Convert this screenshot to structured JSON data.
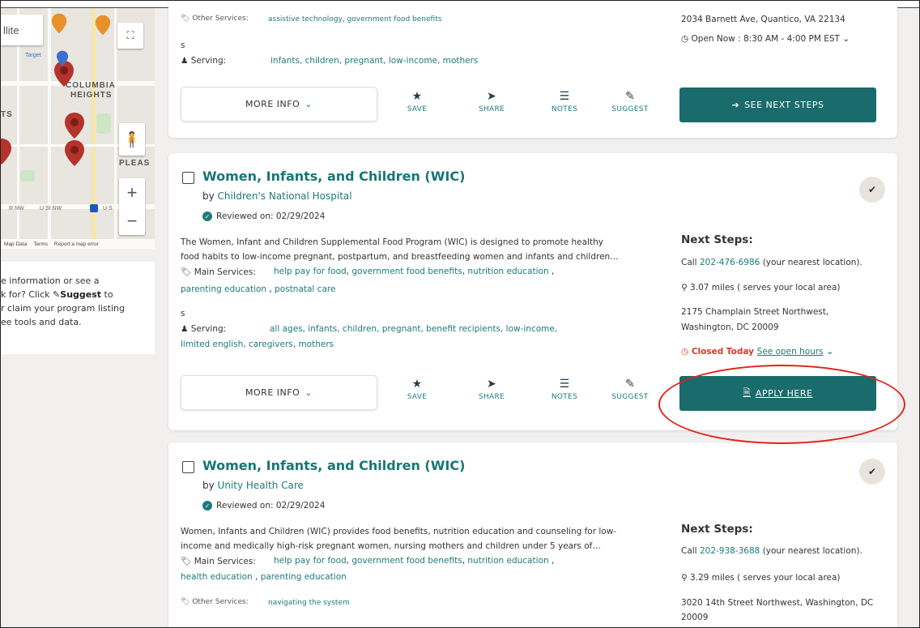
{
  "map": {
    "satellite_label": "llite",
    "target_label": "Target",
    "neighborhood_1": "COLUMBIA",
    "neighborhood_2": "HEIGHTS",
    "neighborhood_3": "PLEAS",
    "left_edge_label": "TS",
    "street_1": "R NW",
    "street_2": "U St NW",
    "street_3": "U S",
    "zoom_in": "+",
    "zoom_out": "−",
    "footer": {
      "map_data": "Map Data",
      "terms": "Terms",
      "report": "Report a map error"
    },
    "pin_color": "#b3342b"
  },
  "left_info": {
    "line1": "e information or see a",
    "line2_pre": "k for? Click ",
    "line2_bold": "Suggest",
    "line2_post": " to",
    "line3": "r claim your program listing",
    "line4": "ee tools and data."
  },
  "card1": {
    "other_services_label": "Other Services:",
    "other_services": [
      "assistive technology",
      "government food benefits"
    ],
    "stray": "s",
    "serving_label": "Serving:",
    "serving": "infants, children, pregnant, low-income, mothers",
    "address": "2034 Barnett Ave, Quantico, VA 22134",
    "hours": "Open Now : 8:30 AM - 4:00 PM EST",
    "more_info": "MORE INFO",
    "actions": [
      "SAVE",
      "SHARE",
      "NOTES",
      "SUGGEST"
    ],
    "cta": "SEE NEXT STEPS"
  },
  "card2": {
    "title": "Women, Infants, and Children (WIC)",
    "by_prefix": "by",
    "provider": "Children's National Hospital",
    "reviewed": "Reviewed on: 02/29/2024",
    "desc_line1": "The Women, Infant and Children Supplemental Food Program (WIC) is designed to promote healthy",
    "desc_line2": "food habits to low-income pregnant, postpartum, and breastfeeding women and infants and children…",
    "main_services_label": "Main Services:",
    "main_services": [
      "help pay for food",
      "government food benefits",
      "nutrition education",
      "parenting education",
      "postnatal care"
    ],
    "stray": "s",
    "serving_label": "Serving:",
    "serving_line1": "all ages, infants, children, pregnant, benefit recipients, low-income,",
    "serving_line2": "limited english, caregivers, mothers",
    "next_steps": "Next Steps:",
    "call_prefix": "Call",
    "phone": "202-476-6986",
    "call_suffix": "(your nearest location).",
    "distance": "3.07 miles ( serves your local area)",
    "address_line1": "2175 Champlain Street Northwest,",
    "address_line2": "Washington, DC 20009",
    "closed": "Closed Today",
    "see_hours": "See open hours",
    "more_info": "MORE INFO",
    "actions": [
      "SAVE",
      "SHARE",
      "NOTES",
      "SUGGEST"
    ],
    "cta": "APPLY HERE"
  },
  "card3": {
    "title": "Women, Infants, and Children (WIC)",
    "by_prefix": "by",
    "provider": "Unity Health Care",
    "reviewed": "Reviewed on: 02/29/2024",
    "desc_line1": "Women, Infants and Children (WIC) provides food benefits, nutrition education and counseling for low-",
    "desc_line2": "income and medically high-risk pregnant women, nursing mothers and children under 5 years of…",
    "main_services_label": "Main Services:",
    "main_services": [
      "help pay for food",
      "government food benefits",
      "nutrition education",
      "health education",
      "parenting education"
    ],
    "other_services_label": "Other Services:",
    "other_services": [
      "navigating the system"
    ],
    "next_steps": "Next Steps:",
    "call_prefix": "Call",
    "phone": "202-938-3688",
    "call_suffix": "(your nearest location).",
    "distance": "3.29 miles ( serves your local area)",
    "address_line1": "3020 14th Street Northwest, Washington, DC",
    "address_line2": "20009"
  },
  "colors": {
    "teal": "#1b7b7a",
    "button": "#1a6b6b",
    "closed": "#d8392a",
    "annotation": "#e0231b"
  }
}
